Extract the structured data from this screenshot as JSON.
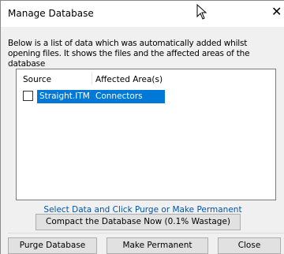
{
  "window": {
    "title": "Manage Database",
    "close_glyph": "✕"
  },
  "description": "Below is a list of data which was automatically added whilst opening files. It shows the files and the affected areas of the database",
  "list": {
    "columns": [
      "Source",
      "Affected Area(s)"
    ],
    "rows": [
      {
        "checked": false,
        "source": "Straight.ITM",
        "area": "Connectors",
        "selected": true
      }
    ]
  },
  "hint": "Select Data and Click Purge or Make Permanent",
  "compact_label": "Compact the Database Now (0.1% Wastage)",
  "buttons": {
    "purge": "Purge Database",
    "permanent": "Make Permanent",
    "close": "Close"
  },
  "colors": {
    "selection": "#0078d7",
    "hint_text": "#0055aa",
    "button_face": "#e1e1e1"
  }
}
